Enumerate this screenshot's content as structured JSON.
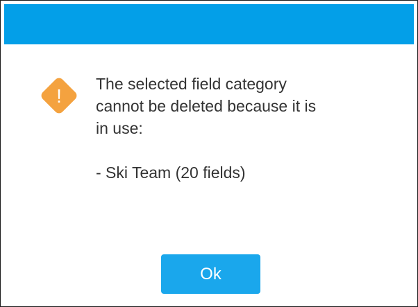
{
  "dialog": {
    "accent_color": "#039fe8",
    "icon": "warning-icon",
    "icon_glyph": "!",
    "icon_color": "#f4a23f",
    "message_lines": [
      "The selected field category",
      "cannot be deleted because it is",
      "in use:"
    ],
    "items": [
      "- Ski Team (20 fields)"
    ],
    "ok_label": "Ok",
    "button_color": "#1aa7ec"
  }
}
